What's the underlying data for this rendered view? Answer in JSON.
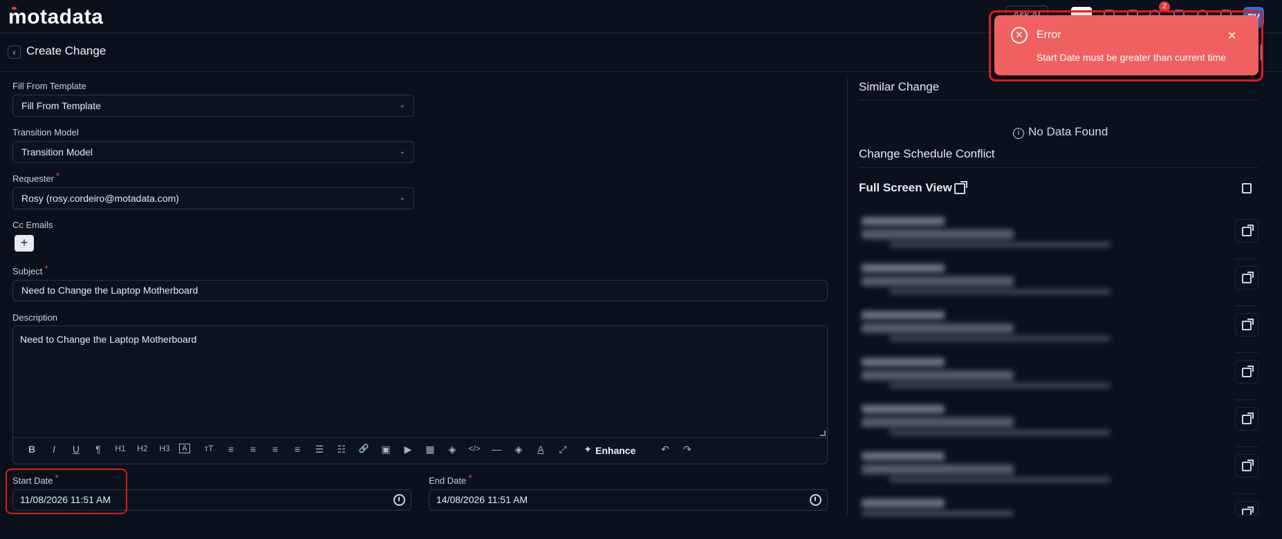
{
  "app": {
    "logo": "motadata"
  },
  "topbar": {
    "ask_ai": "Ask AI",
    "notification_count": "2",
    "avatar_initials": "RV"
  },
  "page": {
    "title": "Create Change"
  },
  "form": {
    "fill_from_template": {
      "label": "Fill From Template",
      "value": "Fill From Template"
    },
    "transition_model": {
      "label": "Transition Model",
      "value": "Transition Model"
    },
    "requester": {
      "label": "Requester",
      "required": "*",
      "value": "Rosy (rosy.cordeiro@motadata.com)"
    },
    "cc_emails": {
      "label": "Cc Emails",
      "add": "+"
    },
    "subject": {
      "label": "Subject",
      "required": "*",
      "value": "Need to Change the Laptop Motherboard"
    },
    "description": {
      "label": "Description",
      "value": "Need to Change the Laptop Motherboard",
      "enhance_label": "Enhance"
    },
    "start_date": {
      "label": "Start Date",
      "required": "*",
      "value": "11/08/2026 11:51 AM"
    },
    "end_date": {
      "label": "End Date",
      "required": "*",
      "value": "14/08/2026 11:51 AM"
    }
  },
  "toolbar_buttons": [
    "B",
    "I",
    "U",
    "¶",
    "H1",
    "H2",
    "H3",
    "A",
    "тT",
    "≡",
    "≡",
    "≡",
    "≡",
    "☰",
    "☷",
    "🔗",
    "▣",
    "▶",
    "▦",
    "◈",
    "</>",
    "—",
    "◈",
    "A",
    "⤢"
  ],
  "right_panel": {
    "similar_change": "Similar Change",
    "no_data": "No Data Found",
    "change_schedule_conflict": "Change Schedule Conflict",
    "full_screen_view": "Full Screen View"
  },
  "toast": {
    "title": "Error",
    "message": "Start Date must be greater than current time",
    "close": "✕",
    "icon": "x-circle-icon",
    "color": "#f06060"
  },
  "colors": {
    "background": "#0a111d",
    "error": "#f06060",
    "required": "#f04a4a"
  }
}
